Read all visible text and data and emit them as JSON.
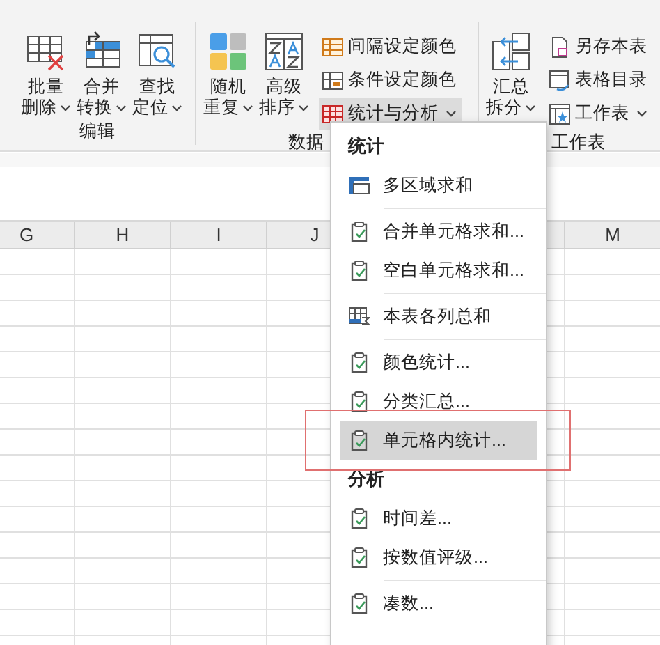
{
  "ribbon": {
    "groups": [
      {
        "label": "编辑",
        "large": [
          {
            "label": "批量删除",
            "dropdown": true
          },
          {
            "label": "合并转换",
            "dropdown": true
          },
          {
            "label": "查找定位",
            "dropdown": true
          }
        ]
      },
      {
        "label": "数据",
        "large": [
          {
            "label": "随机重复",
            "dropdown": true
          },
          {
            "label": "高级排序",
            "dropdown": true
          }
        ],
        "small": [
          {
            "label": "间隔设定颜色",
            "dropdown": false,
            "pressed": false
          },
          {
            "label": "条件设定颜色",
            "dropdown": false,
            "pressed": false
          },
          {
            "label": "统计与分析",
            "dropdown": true,
            "pressed": true
          }
        ]
      },
      {
        "label": "工作表",
        "large": [
          {
            "label": "汇总拆分",
            "dropdown": true
          }
        ],
        "small": [
          {
            "label": "另存本表",
            "dropdown": false,
            "pressed": false
          },
          {
            "label": "表格目录",
            "dropdown": false,
            "pressed": false
          },
          {
            "label": "工作表",
            "dropdown": true,
            "pressed": false
          }
        ]
      }
    ]
  },
  "sheet": {
    "columns": [
      "G",
      "H",
      "I",
      "J",
      "M"
    ]
  },
  "menu": {
    "sections": [
      {
        "title": "统计",
        "groups": [
          [
            {
              "label": "多区域求和",
              "kind": "range",
              "selected": false,
              "annotated": false
            }
          ],
          [
            {
              "label": "合并单元格求和...",
              "kind": "dialog",
              "selected": false,
              "annotated": false
            },
            {
              "label": "空白单元格求和...",
              "kind": "dialog",
              "selected": false,
              "annotated": false
            }
          ],
          [
            {
              "label": "本表各列总和",
              "kind": "columns",
              "selected": false,
              "annotated": false
            }
          ],
          [
            {
              "label": "颜色统计...",
              "kind": "dialog",
              "selected": false,
              "annotated": false
            },
            {
              "label": "分类汇总...",
              "kind": "dialog",
              "selected": false,
              "annotated": false
            },
            {
              "label": "单元格内统计...",
              "kind": "dialog",
              "selected": true,
              "annotated": true
            }
          ]
        ]
      },
      {
        "title": "分析",
        "groups": [
          [
            {
              "label": "时间差...",
              "kind": "dialog",
              "selected": false,
              "annotated": false
            },
            {
              "label": "按数值评级...",
              "kind": "dialog",
              "selected": false,
              "annotated": false
            }
          ],
          [
            {
              "label": "凑数...",
              "kind": "dialog",
              "selected": false,
              "annotated": false
            }
          ]
        ]
      }
    ]
  }
}
